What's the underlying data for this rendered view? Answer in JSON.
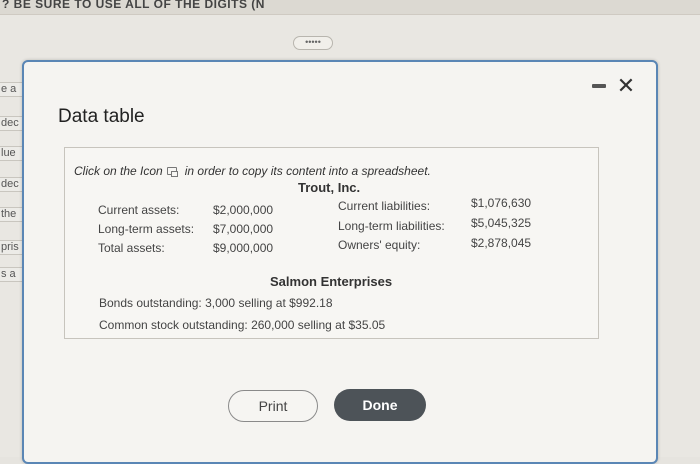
{
  "background": {
    "top_text": "? BE SURE TO USE ALL OF THE DIGITS (N",
    "more_label": "•••••",
    "left_fragments": [
      "e a",
      "dec",
      "lue",
      "dec",
      "the",
      "pris",
      "s a"
    ]
  },
  "dialog": {
    "title": "Data table",
    "instruction_before": "Click on the Icon",
    "instruction_after": "in order to copy its content into a spreadsheet.",
    "trout": {
      "name": "Trout, Inc.",
      "assets": [
        {
          "label": "Current assets:",
          "value": "$2,000,000"
        },
        {
          "label": "Long-term assets:",
          "value": "$7,000,000"
        },
        {
          "label": "Total assets:",
          "value": "$9,000,000"
        }
      ],
      "liabilities": [
        {
          "label": "Current liabilities:",
          "value": "$1,076,630"
        },
        {
          "label": "Long-term liabilities:",
          "value": "$5,045,325"
        },
        {
          "label": "Owners' equity:",
          "value": "$2,878,045"
        }
      ]
    },
    "salmon": {
      "name": "Salmon Enterprises",
      "bonds": "Bonds outstanding: 3,000 selling at $992.18",
      "stock": "Common stock outstanding: 260,000 selling at $35.05"
    },
    "buttons": {
      "print": "Print",
      "done": "Done"
    }
  }
}
